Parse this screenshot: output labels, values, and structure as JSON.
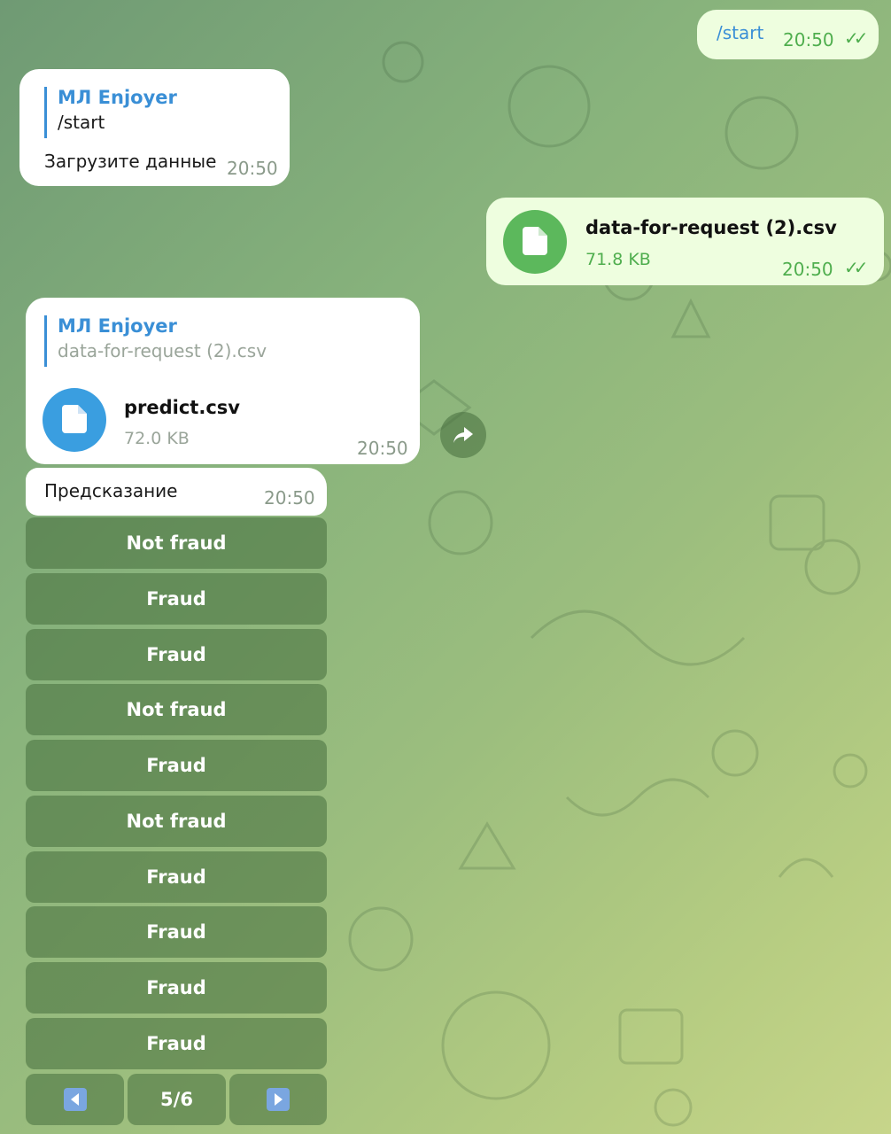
{
  "messages": {
    "m1": {
      "text": "/start",
      "time": "20:50",
      "read": "✓✓"
    },
    "m2": {
      "reply_name": "МЛ Enjoyer",
      "reply_text": "/start",
      "text": "Загрузите данные",
      "time": "20:50"
    },
    "m3": {
      "file_name": "data-for-request (2).csv",
      "file_size": "71.8 KB",
      "time": "20:50",
      "read": "✓✓"
    },
    "m4": {
      "reply_name": "МЛ Enjoyer",
      "reply_text": "data-for-request (2).csv",
      "file_name": "predict.csv",
      "file_size": "72.0 KB",
      "time": "20:50"
    },
    "m5": {
      "text": "Предсказание",
      "time": "20:50"
    }
  },
  "keyboard": {
    "buttons": [
      "Not fraud",
      "Fraud",
      "Fraud",
      "Not fraud",
      "Fraud",
      "Not fraud",
      "Fraud",
      "Fraud",
      "Fraud",
      "Fraud"
    ],
    "page": "5/6"
  },
  "colors": {
    "accent_blue": "#3a8fd6",
    "out_green": "#4fae4e",
    "file_blue": "#3a9ee0",
    "file_green": "#5cb85c"
  },
  "icons": {
    "file": "document-icon",
    "share": "share-icon",
    "prev": "prev-arrow-icon",
    "next": "next-arrow-icon"
  }
}
